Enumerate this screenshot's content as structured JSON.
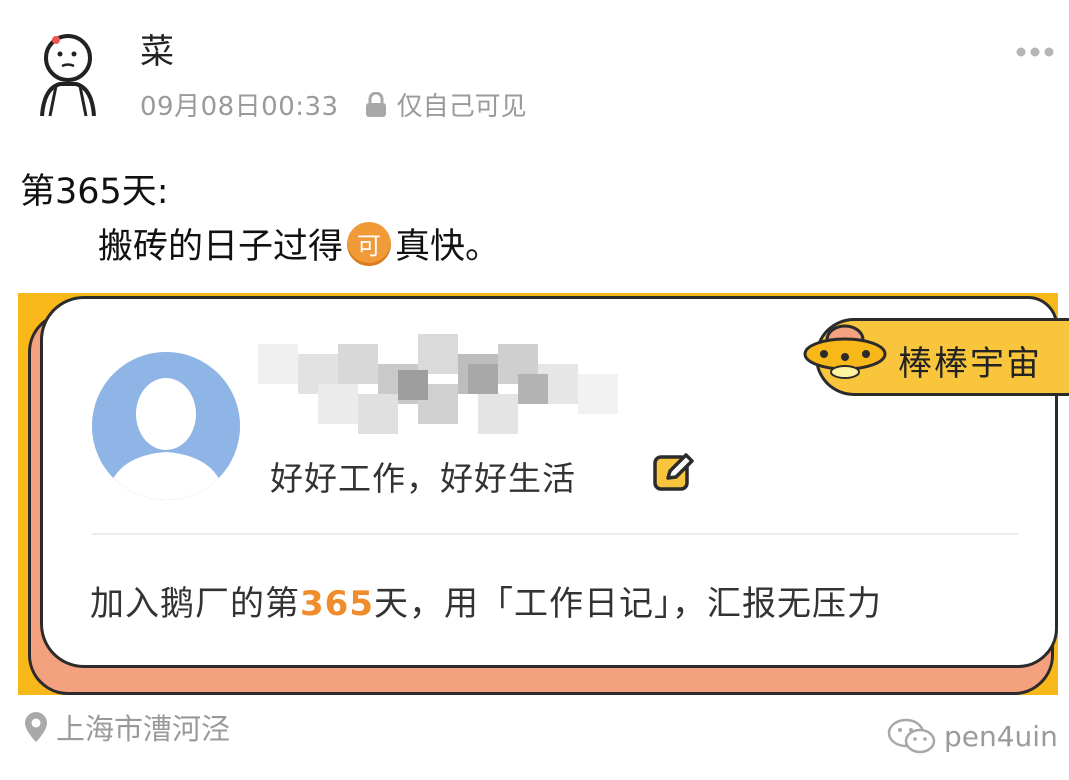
{
  "post": {
    "username": "菜",
    "timestamp": "09月08日00:33",
    "visibility": "仅自己可见",
    "title": "第365天:",
    "body_before": "搬砖的日子过得",
    "emoji_char": "可",
    "body_after": "真快。",
    "location": "上海市漕河泾"
  },
  "card": {
    "badge": "棒棒宇宙",
    "signature": "好好工作，好好生活",
    "join_prefix": "加入鹅厂的第",
    "join_days": "365",
    "join_suffix": "天，用「工作日记」，汇报无压力"
  },
  "watermark": "pen4uin",
  "icons": {
    "lock": "lock-icon",
    "more": "more-dots-icon",
    "edit": "edit-icon",
    "location": "location-pin-icon",
    "ufo": "ufo-icon",
    "wechat": "wechat-icon"
  },
  "colors": {
    "card_yellow": "#f8b81a",
    "card_salmon": "#f3a17f",
    "accent_orange": "#f08c2c",
    "badge_yellow": "#f8c53c",
    "muted_gray": "#9a9a9a"
  }
}
